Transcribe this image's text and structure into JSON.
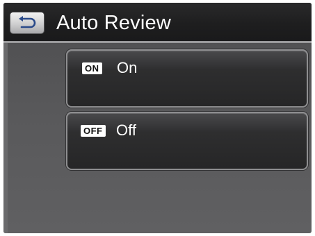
{
  "header": {
    "title": "Auto Review",
    "back_icon": "back-arrow-icon"
  },
  "options": [
    {
      "badge": "ON",
      "label": "On"
    },
    {
      "badge": "OFF",
      "label": "Off"
    }
  ],
  "colors": {
    "background": "#59595b",
    "header": "#1e1e1f",
    "option_bg": "#2e2e2f",
    "text": "#ffffff"
  }
}
